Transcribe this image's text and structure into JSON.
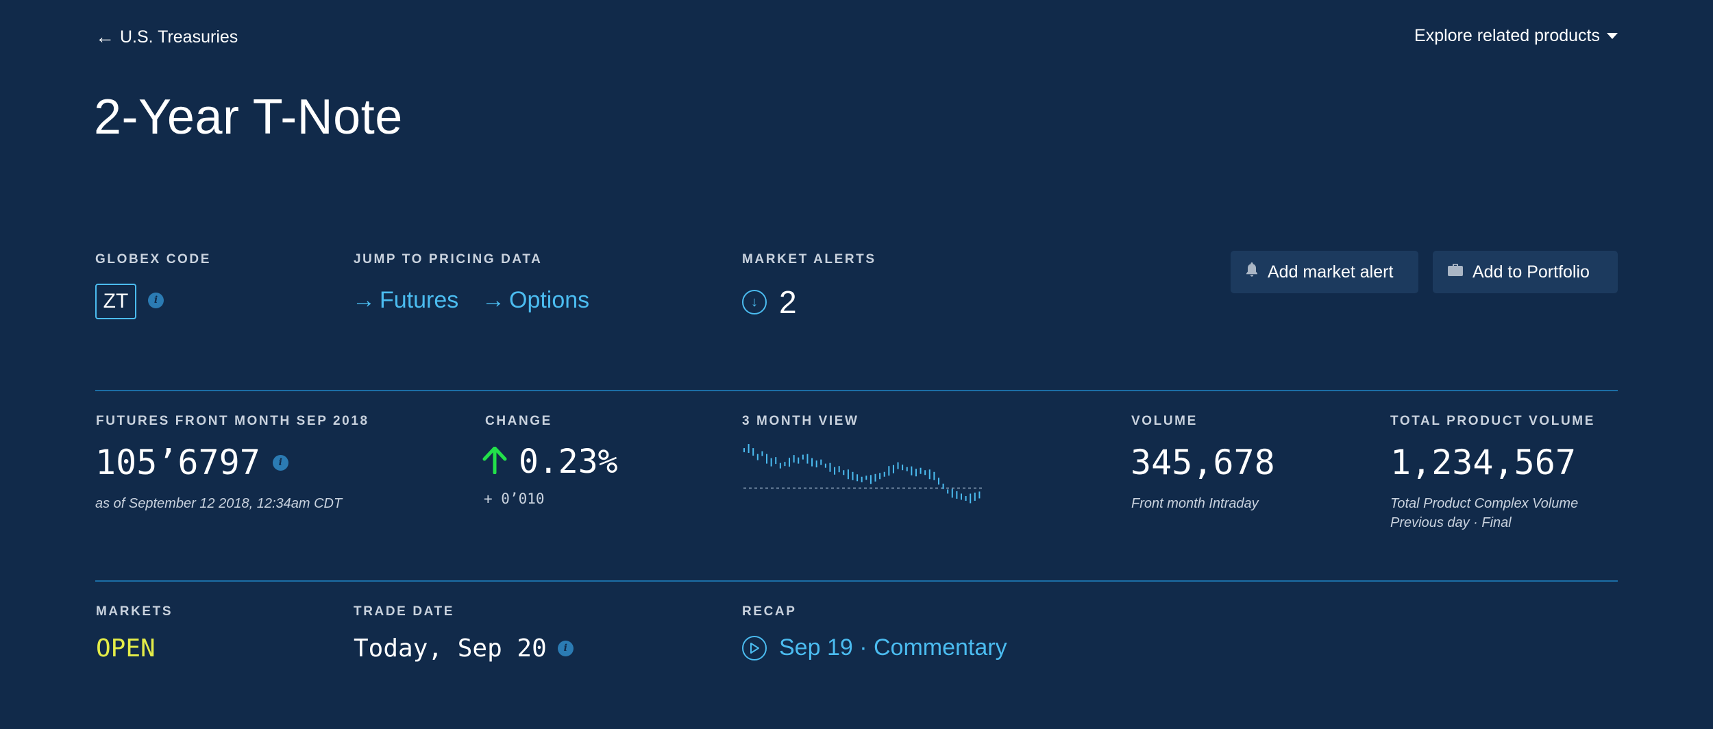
{
  "nav": {
    "back_label": "U.S. Treasuries",
    "explore_label": "Explore related products"
  },
  "page_title": "2-Year T-Note",
  "globex": {
    "label": "GLOBEX CODE",
    "code": "ZT"
  },
  "jump": {
    "label": "JUMP TO PRICING DATA",
    "futures": "Futures",
    "options": "Options"
  },
  "alerts": {
    "label": "MARKET ALERTS",
    "count": "2"
  },
  "buttons": {
    "add_alert": "Add market alert",
    "add_portfolio": "Add to Portfolio"
  },
  "futures": {
    "label": "FUTURES FRONT MONTH SEP 2018",
    "price": "105’6797",
    "asof": "as of September 12 2018, 12:34am CDT"
  },
  "change": {
    "label": "CHANGE",
    "percent": "0.23%",
    "delta": "+ 0’010"
  },
  "three_month": {
    "label": "3 MONTH VIEW"
  },
  "volume": {
    "label": "VOLUME",
    "value": "345,678",
    "note": "Front month Intraday"
  },
  "total_volume": {
    "label": "TOTAL PRODUCT VOLUME",
    "value": "1,234,567",
    "note_line1": "Total Product Complex Volume",
    "note_line2": "Previous day · Final"
  },
  "markets": {
    "label": "MARKETS",
    "status": "OPEN"
  },
  "trade_date": {
    "label": "TRADE DATE",
    "value": "Today, Sep 20"
  },
  "recap": {
    "label": "RECAP",
    "link": "Sep 19 · Commentary"
  },
  "colors": {
    "background": "#112a4a",
    "accent": "#4bbcf0",
    "up": "#22e04a",
    "open": "#e4ec48",
    "divider": "#1c6ea6"
  },
  "chart_data": {
    "type": "bar",
    "values": [
      62,
      63,
      61,
      58,
      60,
      57,
      55,
      56,
      53,
      54,
      55,
      57,
      56,
      58,
      57,
      55,
      54,
      55,
      53,
      52,
      50,
      51,
      49,
      48,
      47,
      46,
      45,
      46,
      45,
      46,
      47,
      48,
      50,
      51,
      53,
      52,
      51,
      50,
      49,
      50,
      49,
      48,
      47,
      44,
      41,
      38,
      37,
      36,
      35,
      34,
      34,
      35,
      36
    ]
  }
}
